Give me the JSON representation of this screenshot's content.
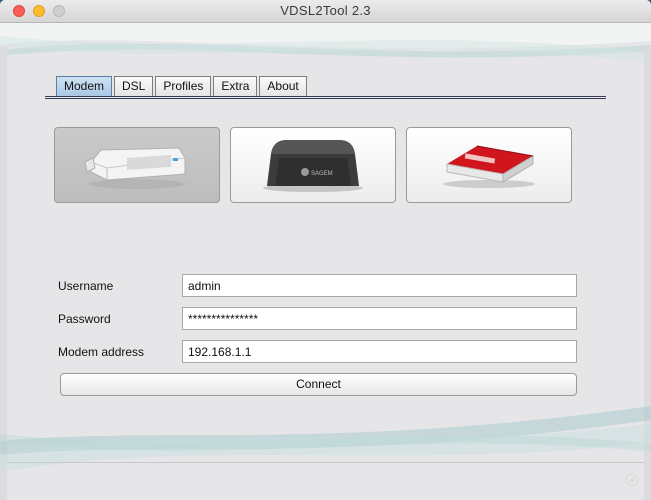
{
  "window": {
    "title": "VDSL2Tool 2.3"
  },
  "tabs": [
    {
      "label": "Modem",
      "active": true
    },
    {
      "label": "DSL",
      "active": false
    },
    {
      "label": "Profiles",
      "active": false
    },
    {
      "label": "Extra",
      "active": false
    },
    {
      "label": "About",
      "active": false
    }
  ],
  "devices": [
    {
      "icon": "white-vdsl-modem-icon",
      "selected": true
    },
    {
      "icon": "black-sagem-router-icon",
      "brand_text": "SAGEM",
      "selected": false
    },
    {
      "icon": "red-fritzbox-router-icon",
      "selected": false
    }
  ],
  "form": {
    "username_label": "Username",
    "username_value": "admin",
    "password_label": "Password",
    "password_value": "***************",
    "address_label": "Modem address",
    "address_value": "192.168.1.1",
    "connect_label": "Connect"
  },
  "colors": {
    "active_tab": "#a9c8e4",
    "wave": "#9fc6c4",
    "close": "#fc5f57",
    "minimize": "#fdbc2e"
  }
}
